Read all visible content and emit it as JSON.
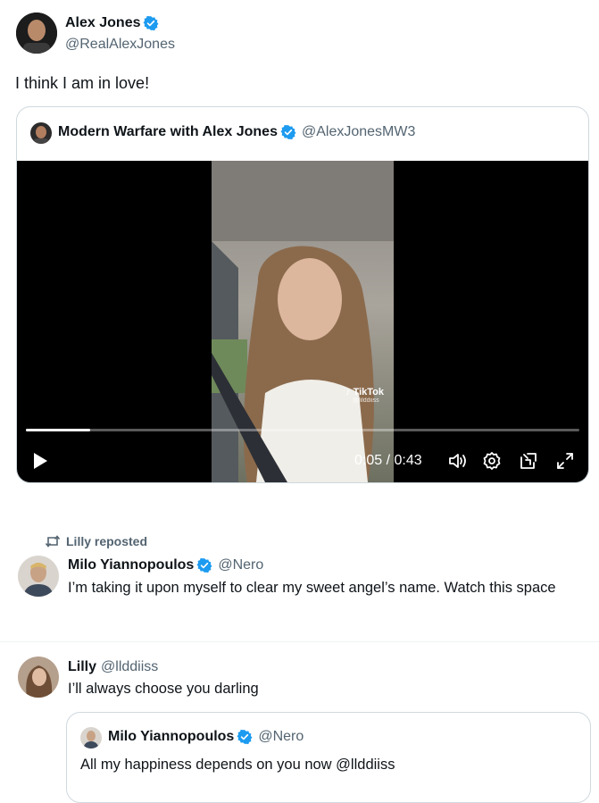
{
  "main_post": {
    "author_name": "Alex Jones",
    "author_handle": "@RealAlexJones",
    "text": "I think I am in love!"
  },
  "quoted_post": {
    "author_name": "Modern Warfare with Alex Jones",
    "author_handle": "@AlexJonesMW3",
    "video": {
      "time_label": "0:05 / 0:43",
      "progress": 0.116,
      "watermark": "TikTok",
      "watermark_sub": "@lilddiiss"
    }
  },
  "repost": {
    "reposted_by": "Lilly reposted",
    "author_name": "Milo Yiannopoulos",
    "author_handle": "@Nero",
    "text": "I’m taking it upon myself to clear my sweet angel’s name. Watch this space"
  },
  "reply_post": {
    "author_name": "Lilly",
    "author_handle": "@llddiiss",
    "text": "I’ll always choose you darling",
    "quote": {
      "author_name": "Milo Yiannopoulos",
      "author_handle": "@Nero",
      "text": "All my happiness depends on you now @llddiiss"
    }
  },
  "colors": {
    "verified_blue": "#1d9bf0",
    "muted_text": "#536471",
    "border": "#cfd9de",
    "video_bg": "#000000"
  },
  "icons": [
    "verified-badge-icon",
    "play-icon",
    "volume-icon",
    "settings-icon",
    "picture-in-picture-icon",
    "fullscreen-icon",
    "repost-icon"
  ]
}
